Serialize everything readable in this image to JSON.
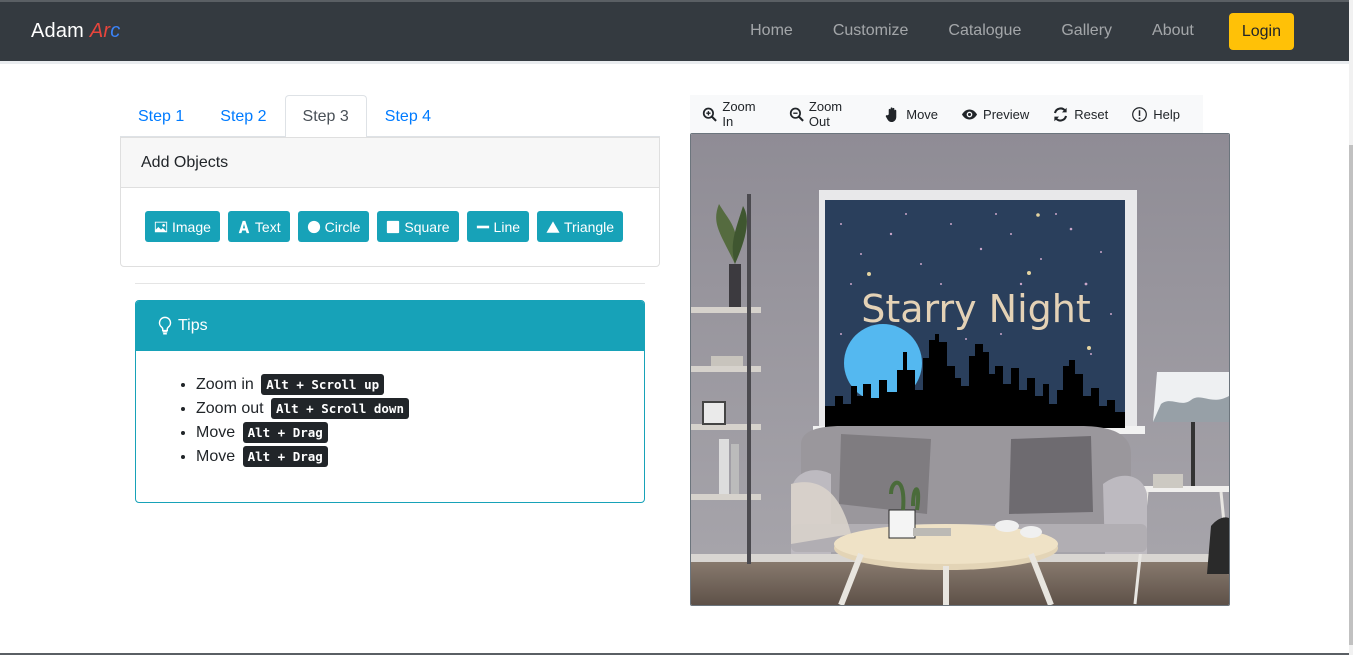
{
  "navbar": {
    "brand_first": "Adam",
    "brand_second": "Arc",
    "links": [
      "Home",
      "Customize",
      "Catalogue",
      "Gallery",
      "About"
    ],
    "login_label": "Login"
  },
  "steps": {
    "tabs": [
      "Step 1",
      "Step 2",
      "Step 3",
      "Step 4"
    ],
    "active": "Step 3"
  },
  "add_objects": {
    "title": "Add Objects",
    "buttons": [
      {
        "label": "Image",
        "icon": "image-icon"
      },
      {
        "label": "Text",
        "icon": "text-icon"
      },
      {
        "label": "Circle",
        "icon": "circle-icon"
      },
      {
        "label": "Square",
        "icon": "square-icon"
      },
      {
        "label": "Line",
        "icon": "line-icon"
      },
      {
        "label": "Triangle",
        "icon": "triangle-icon"
      }
    ]
  },
  "tips": {
    "title": "Tips",
    "items": [
      {
        "label": "Zoom in",
        "shortcut": "Alt + Scroll up"
      },
      {
        "label": "Zoom out",
        "shortcut": "Alt + Scroll down"
      },
      {
        "label": "Move",
        "shortcut": "Alt + Drag"
      },
      {
        "label": "Move",
        "shortcut": "Alt + Drag"
      }
    ]
  },
  "toolbar": {
    "items": [
      {
        "label": "Zoom In",
        "icon": "zoom-in-icon"
      },
      {
        "label": "Zoom Out",
        "icon": "zoom-out-icon"
      },
      {
        "label": "Move",
        "icon": "hand-icon"
      },
      {
        "label": "Preview",
        "icon": "eye-icon"
      },
      {
        "label": "Reset",
        "icon": "reset-icon"
      },
      {
        "label": "Help",
        "icon": "help-icon"
      }
    ]
  },
  "canvas": {
    "design_text": "Starry Night"
  },
  "colors": {
    "navbar": "#343a40",
    "accent": "#17a2b8",
    "login": "#ffc107",
    "link": "#007bff"
  }
}
